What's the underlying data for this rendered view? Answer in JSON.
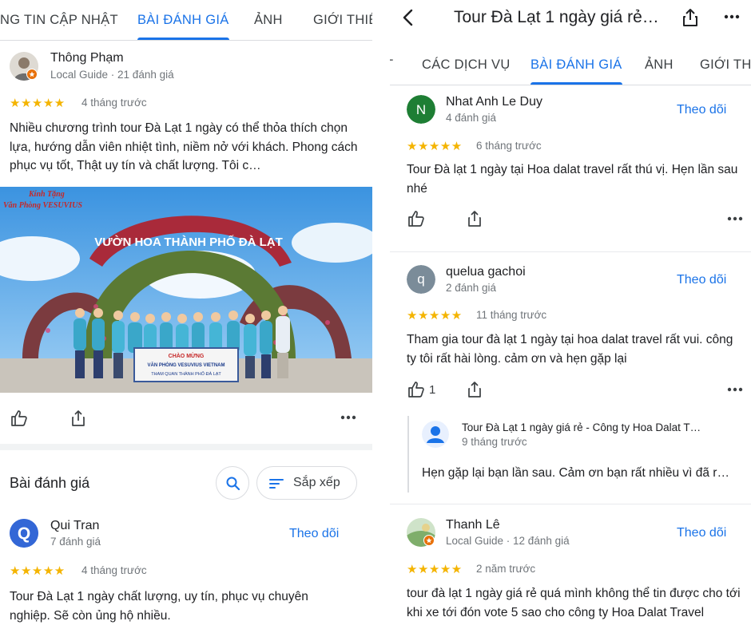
{
  "left": {
    "tabs": [
      "NG TIN CẬP NHẬT",
      "BÀI ĐÁNH GIÁ",
      "ẢNH",
      "GIỚI THIỆ"
    ],
    "review1": {
      "author": "Thông Phạm",
      "meta": "Local Guide · 21 đánh giá",
      "stars": "★★★★★",
      "when": "4 tháng trước",
      "text": "Nhiều chương trình tour Đà Lạt 1 ngày có thể thỏa thích chọn lựa, hướng dẫn viên  nhiệt tình, niềm nở với khách. Phong cách phục vụ tốt, Thật uy tín và chất lượng. Tôi c…",
      "photo": {
        "corner_line1": "Kính Tặng",
        "corner_line2": "Văn Phòng VESUVIUS",
        "arch_sign": "VƯỜN HOA THÀNH PHỐ ĐÀ LẠT",
        "banner_line1": "CHÀO MỪNG",
        "banner_line2": "VĂN PHÒNG VESUVIUS VIETNAM",
        "banner_line3": "THAM QUAN THÀNH PHỐ ĐÀ LẠT"
      }
    },
    "section_title": "Bài đánh giá",
    "sort_label": "Sắp xếp",
    "review2": {
      "avatar_letter": "Q",
      "author": "Qui Tran",
      "meta": "7 đánh giá",
      "follow": "Theo dõi",
      "stars": "★★★★★",
      "when": "4 tháng trước",
      "text": "Tour Đà Lạt 1 ngày chất lượng, uy tín, phục vụ chuyên nghiệp. Sẽ còn ủng hộ nhiều."
    }
  },
  "right": {
    "header_title": "Tour Đà Lạt 1 ngày giá rẻ…",
    "tabs": [
      "T",
      "CÁC DỊCH VỤ",
      "BÀI ĐÁNH GIÁ",
      "ẢNH",
      "GIỚI THI"
    ],
    "review1": {
      "avatar_letter": "N",
      "author": "Nhat Anh Le Duy",
      "meta": "4 đánh giá",
      "follow": "Theo dõi",
      "stars": "★★★★★",
      "when": "6 tháng trước",
      "text": "Tour Đà lạt 1 ngày tại Hoa dalat travel rất thú vị. Hẹn lần sau nhé"
    },
    "review2": {
      "avatar_letter": "q",
      "author": "quelua gachoi",
      "meta": "2 đánh giá",
      "follow": "Theo dõi",
      "stars": "★★★★★",
      "when": "11 tháng trước",
      "text": "Tham gia tour đà lạt 1 ngày tại hoa dalat travel rất vui. công ty tôi rất hài lòng. cảm ơn và hẹn gặp lại",
      "like_count": "1",
      "owner_reply": {
        "name": "Tour Đà Lạt 1 ngày giá rẻ - Công ty Hoa Dalat T…",
        "when": "9 tháng trước",
        "text": "Hẹn gặp lại bạn lần sau. Cảm ơn bạn rất nhiều vì đã r…"
      }
    },
    "review3": {
      "author": "Thanh Lê",
      "meta": "Local Guide · 12 đánh giá",
      "follow": "Theo dõi",
      "stars": "★★★★★",
      "when": "2 năm trước",
      "text": "tour đà lạt 1 ngày giá rẻ quá mình không thể tin được cho tới khi xe tới đón vote 5 sao cho công ty Hoa Dalat Travel"
    }
  },
  "colors": {
    "accent": "#1a73e8",
    "star": "#f4b400",
    "avatar_n": "#1e7e34",
    "avatar_q": "#7b8c99",
    "avatar_qui": "#3367d6"
  }
}
